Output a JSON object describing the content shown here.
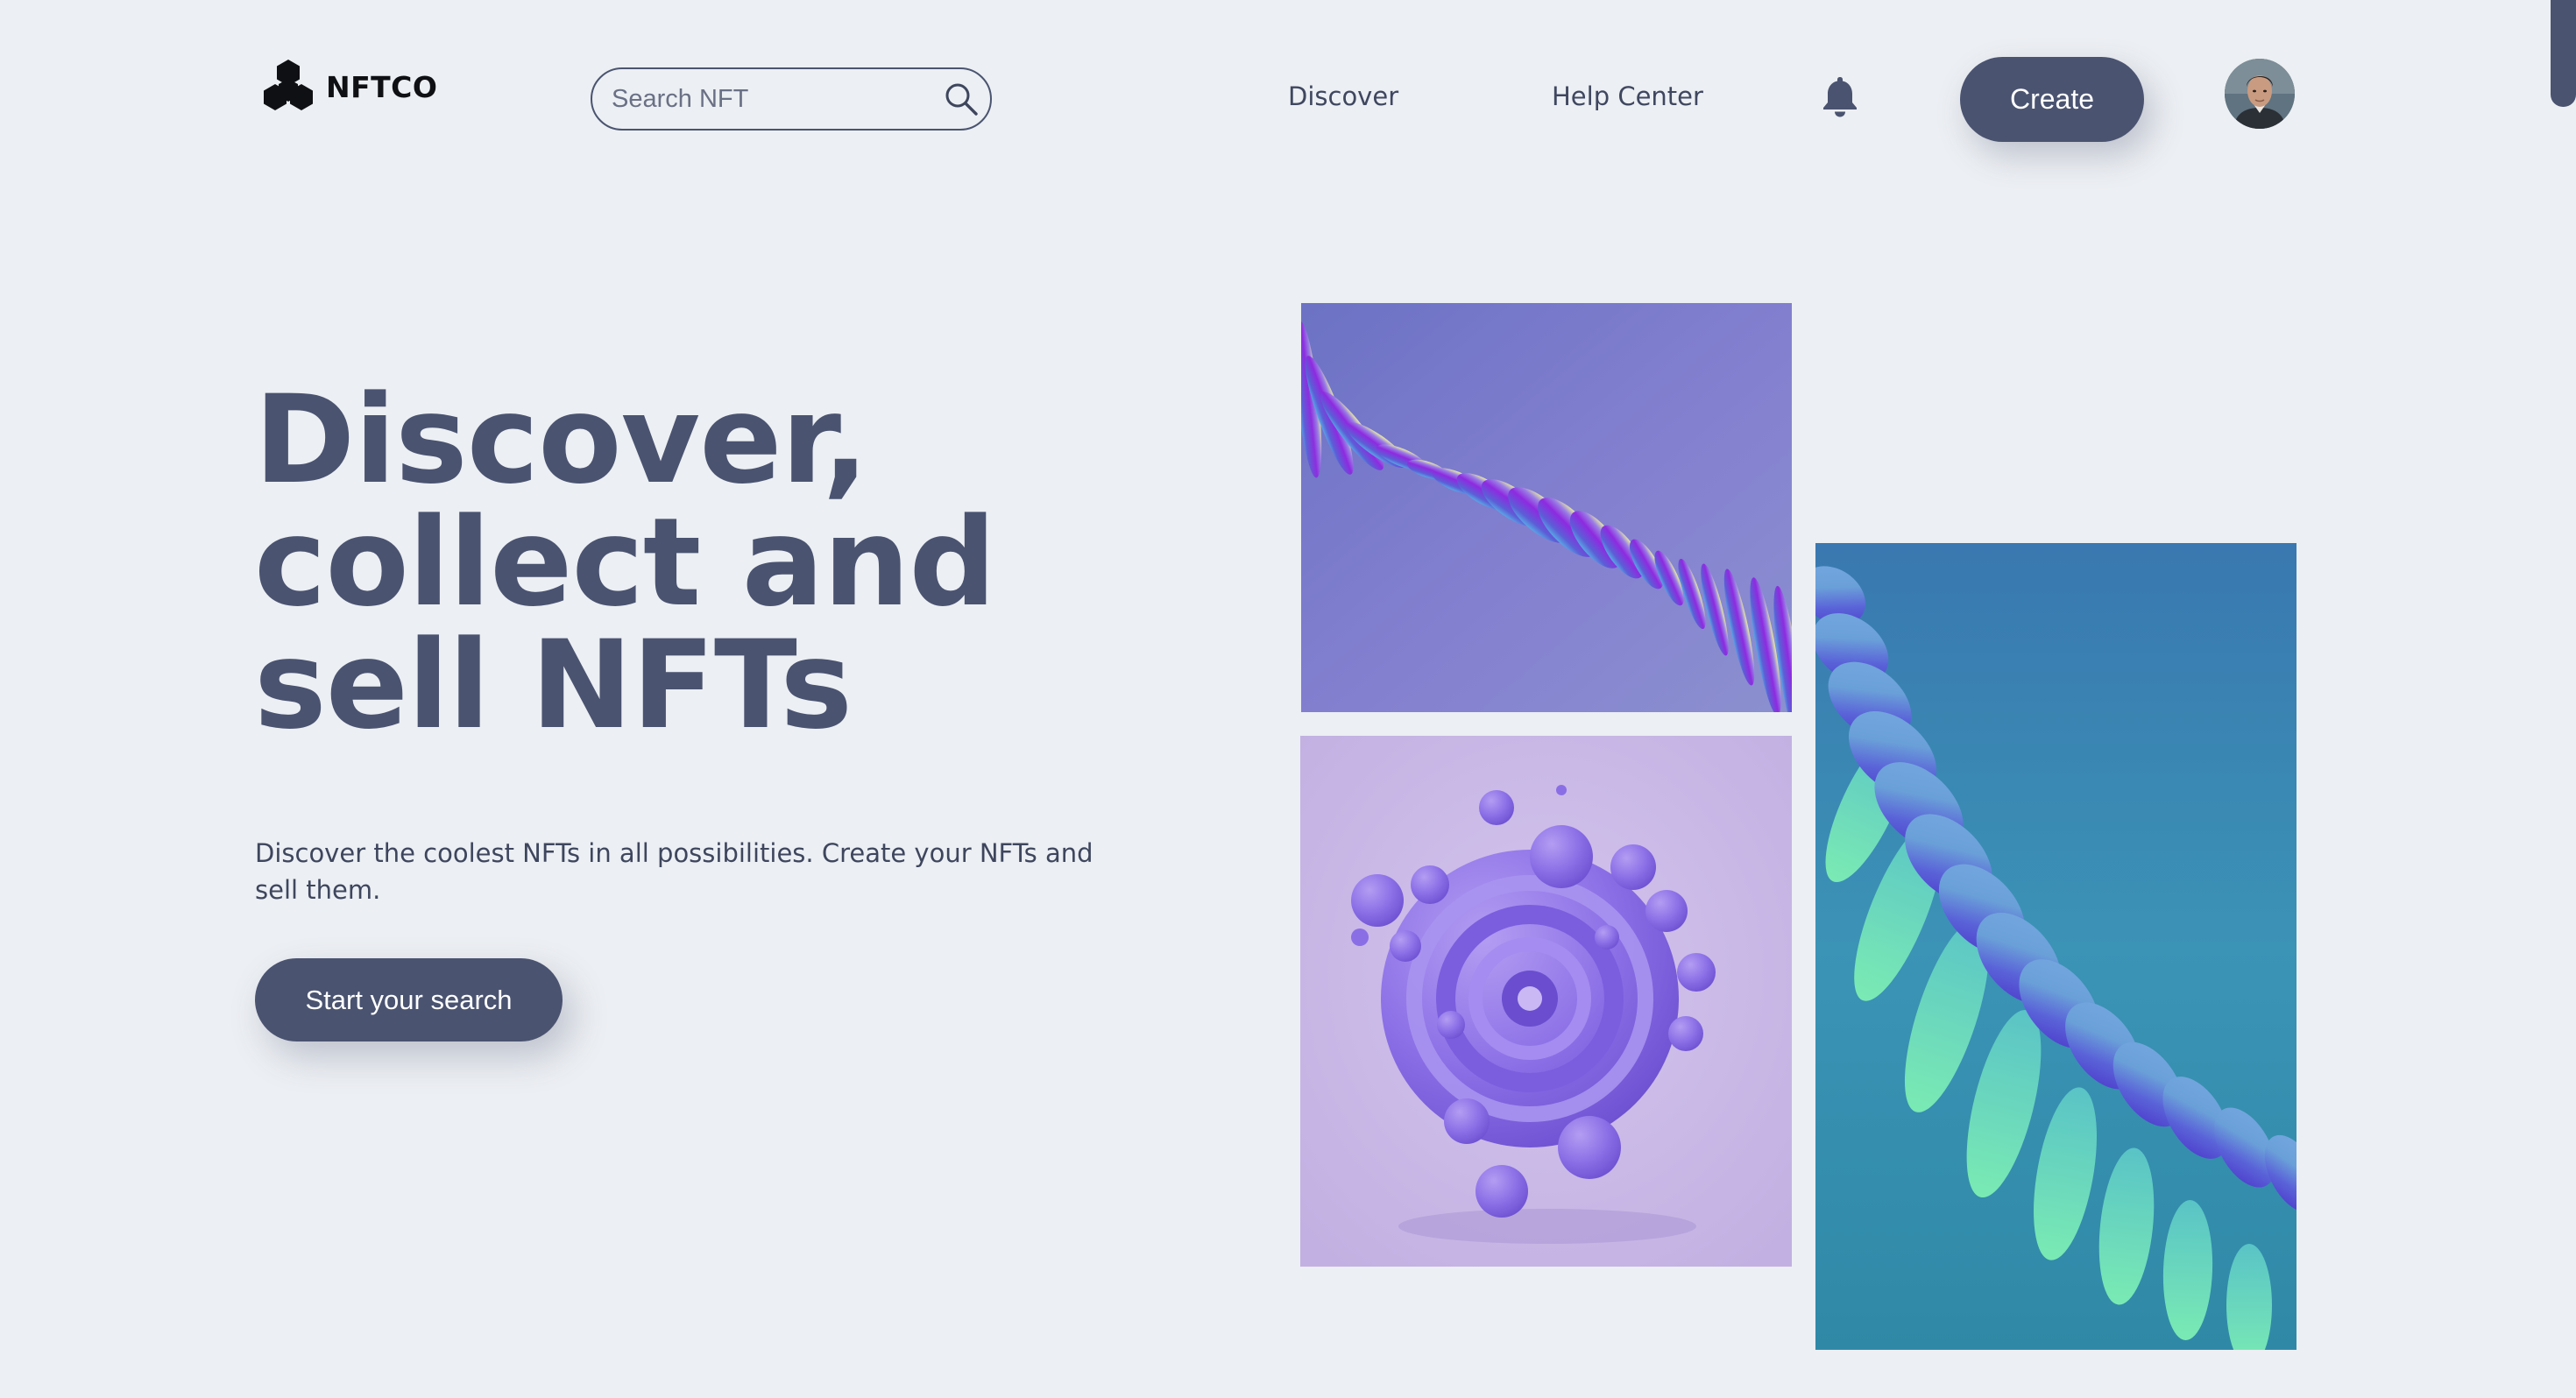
{
  "brand": {
    "name": "NFTCO",
    "logo_icon": "hexagon-cluster-logo-icon"
  },
  "search": {
    "placeholder": "Search NFT",
    "icon": "search-icon"
  },
  "nav": {
    "discover_label": "Discover",
    "help_label": "Help Center",
    "notifications_icon": "bell-icon",
    "create_label": "Create"
  },
  "hero": {
    "title_lines": [
      "Discover,",
      "collect and",
      "sell NFTs"
    ],
    "description": "Discover the coolest NFTs in all possibilities. Create your NFTs and sell them.",
    "cta_label": "Start your search"
  },
  "colors": {
    "background": "#eceff3",
    "primary": "#4a5370",
    "text": "#3e465e",
    "art_purple": "#7b79cb",
    "art_lilac": "#c9b8e6",
    "art_teal": "#3a8fb5"
  }
}
